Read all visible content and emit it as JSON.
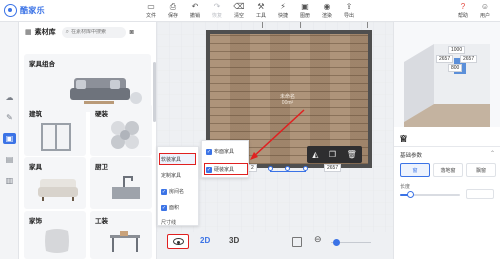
{
  "app": {
    "logo_text": "酷家乐"
  },
  "toolbar": {
    "items": [
      {
        "label": "文件",
        "icon": "file-icon",
        "dim": false
      },
      {
        "label": "保存",
        "icon": "save-icon",
        "dim": false
      },
      {
        "label": "撤销",
        "icon": "undo-icon",
        "dim": false
      },
      {
        "label": "恢复",
        "icon": "redo-icon",
        "dim": true
      },
      {
        "label": "清空",
        "icon": "clear-icon",
        "dim": false
      },
      {
        "label": "工具",
        "icon": "tool-icon",
        "dim": false
      },
      {
        "label": "快捷",
        "icon": "shortcut-icon",
        "dim": false
      },
      {
        "label": "图册",
        "icon": "album-icon",
        "dim": false
      },
      {
        "label": "渲染",
        "icon": "render-icon",
        "dim": false
      },
      {
        "label": "导出",
        "icon": "export-icon",
        "dim": false
      }
    ],
    "right": [
      {
        "label": "帮助",
        "icon": "help-icon"
      },
      {
        "label": "用户",
        "icon": "user-icon"
      }
    ]
  },
  "library": {
    "title": "素材库",
    "search_placeholder": "在素材库中搜索",
    "banner": "家具组合",
    "categories": [
      "建筑",
      "硬装",
      "家具",
      "厨卫",
      "家饰",
      "工装"
    ]
  },
  "view_menu": {
    "items": [
      "软装家具",
      "定制家具",
      "房间名",
      "面积",
      "尺寸线"
    ],
    "checked": [
      false,
      false,
      true,
      true,
      false
    ]
  },
  "view_submenu": {
    "items": [
      "布面家具",
      "硬装家具"
    ],
    "checked": [
      true,
      true
    ]
  },
  "canvas": {
    "room_label_line1": "未命名",
    "room_label_line2": "00m²",
    "dim_top": "2657",
    "dim_bottom": "2657",
    "dim_left": "2"
  },
  "bottom": {
    "view_2d": "2D",
    "view_3d": "3D"
  },
  "preview": {
    "dim_1000": "1000",
    "dim_2657": "2657",
    "dim_2657b": "2657",
    "dim_800": "800"
  },
  "props": {
    "section": "窗",
    "subsection": "基础参数",
    "options": [
      "窗",
      "落地窗",
      "飘窗"
    ],
    "active_option": 0,
    "length_label": "长度"
  },
  "colors": {
    "accent": "#3b73e6",
    "highlight": "#e02020"
  }
}
